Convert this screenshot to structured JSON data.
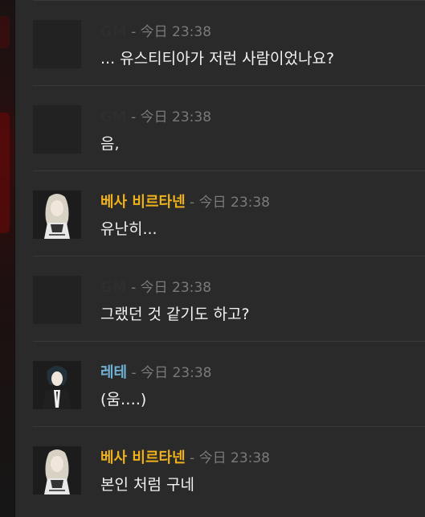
{
  "colors": {
    "gm": "#2e2e2e",
    "besa": "#f0b21a",
    "rete": "#6fb1d4",
    "meta": "#7a7a7a",
    "text": "#f2f2f2"
  },
  "messages": [
    {
      "author": "GM",
      "sep": "-",
      "time": "今日 23:38",
      "text": "... 유스티티아가 저런 사람이었나요?",
      "avatar": "blank"
    },
    {
      "author": "GM",
      "sep": "-",
      "time": "今日 23:38",
      "text": "음,",
      "avatar": "blank"
    },
    {
      "author": "베사 비르타넨",
      "sep": "-",
      "time": "今日 23:38",
      "text": "유난히...",
      "avatar": "besa-portrait"
    },
    {
      "author": "GM",
      "sep": "-",
      "time": "今日 23:38",
      "text": "그랬던 것 같기도 하고?",
      "avatar": "blank"
    },
    {
      "author": "레테",
      "sep": "-",
      "time": "今日 23:38",
      "text": "(움….)",
      "avatar": "rete-portrait"
    },
    {
      "author": "베사 비르타넨",
      "sep": "-",
      "time": "今日 23:38",
      "text": "본인 처럼 구네",
      "avatar": "besa-portrait"
    }
  ]
}
